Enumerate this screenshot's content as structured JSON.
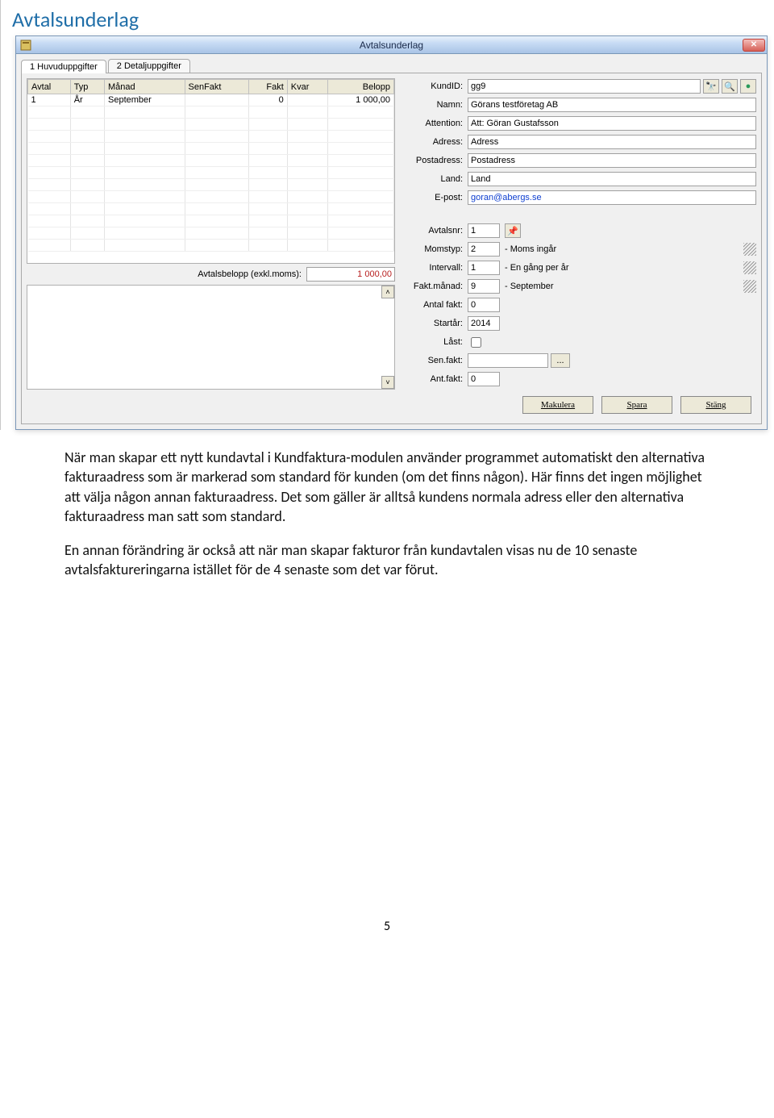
{
  "page_title": "Avtalsunderlag",
  "window_title": "Avtalsunderlag",
  "tabs": [
    {
      "label": "1 Huvuduppgifter"
    },
    {
      "label": "2 Detaljuppgifter"
    }
  ],
  "grid": {
    "columns": [
      "Avtal",
      "Typ",
      "Månad",
      "SenFakt",
      "Fakt",
      "Kvar",
      "Belopp"
    ],
    "rows": [
      {
        "avtal": "1",
        "typ": "År",
        "manad": "September",
        "senfakt": "",
        "fakt": "0",
        "kvar": "",
        "belopp": "1 000,00"
      }
    ]
  },
  "sum_label": "Avtalsbelopp (exkl.moms):",
  "sum_value": "1 000,00",
  "customer": {
    "kundid_label": "KundID:",
    "kundid": "gg9",
    "namn_label": "Namn:",
    "namn": "Görans testföretag AB",
    "attention_label": "Attention:",
    "attention": "Att: Göran Gustafsson",
    "adress_label": "Adress:",
    "adress": "Adress",
    "postadress_label": "Postadress:",
    "postadress": "Postadress",
    "land_label": "Land:",
    "land": "Land",
    "epost_label": "E-post:",
    "epost": "goran@abergs.se"
  },
  "contract": {
    "avtalsnr_label": "Avtalsnr:",
    "avtalsnr": "1",
    "momstyp_label": "Momstyp:",
    "momstyp_code": "2",
    "momstyp_text": " - Moms ingår",
    "intervall_label": "Intervall:",
    "intervall_code": "1",
    "intervall_text": " - En gång per år",
    "faktmanad_label": "Fakt.månad:",
    "faktmanad_code": "9",
    "faktmanad_text": " - September",
    "antalfakt_label": "Antal fakt:",
    "antalfakt": "0",
    "startar_label": "Startår:",
    "startar": "2014",
    "last_label": "Låst:",
    "senfakt_label": "Sen.fakt:",
    "senfakt": "",
    "antfakt_label": "Ant.fakt:",
    "antfakt": "0"
  },
  "dots_button": "...",
  "buttons": {
    "makulera": "Makulera",
    "spara": "Spara",
    "stang": "Stäng"
  },
  "paragraphs": [
    "När man skapar ett nytt kundavtal i Kundfaktura-modulen använder programmet automatiskt den alternativa fakturaadress som är markerad som standard för kunden (om det finns någon). Här finns det ingen möjlighet att välja någon annan fakturaadress. Det som gäller är alltså kundens normala adress eller den alternativa fakturaadress man satt som standard.",
    "En annan förändring är också att när man skapar fakturor från kundavtalen visas nu de 10 senaste avtalsfaktureringarna istället för de 4 senaste som det var förut."
  ],
  "page_number": "5"
}
